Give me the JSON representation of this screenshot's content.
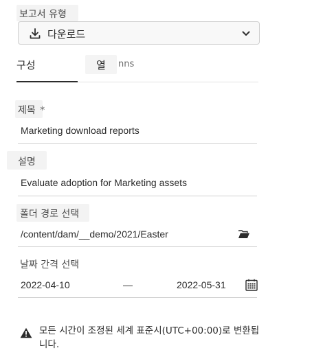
{
  "report_type": {
    "label": "보고서 유형",
    "selected": "다운로드",
    "icon": "download-icon"
  },
  "tabs": [
    {
      "label": "구성",
      "selected": true
    },
    {
      "label": "열",
      "selected": false
    }
  ],
  "tab_overflow_text": "nns",
  "title_field": {
    "label": "제목",
    "required_marker": "*",
    "value": "Marketing download reports"
  },
  "description_field": {
    "label": "설명",
    "value": "Evaluate adoption for Marketing assets"
  },
  "folder_field": {
    "label": "폴더 경로 선택",
    "value": "/content/dam/__demo/2021/Easter",
    "icon": "folder-open-icon"
  },
  "date_range": {
    "label": "날짜 간격 선택",
    "start": "2022-04-10",
    "separator": "—",
    "end": "2022-05-31",
    "icon": "calendar-icon"
  },
  "notice": {
    "icon": "alert-triangle-icon",
    "text": "모든 시간이 조정된 세계 표준시(UTC+00:00)로 변환됩니다."
  },
  "colors": {
    "text": "#2c2c2c",
    "label_highlight": "#f3f3f3",
    "border": "#d0d0d0"
  }
}
